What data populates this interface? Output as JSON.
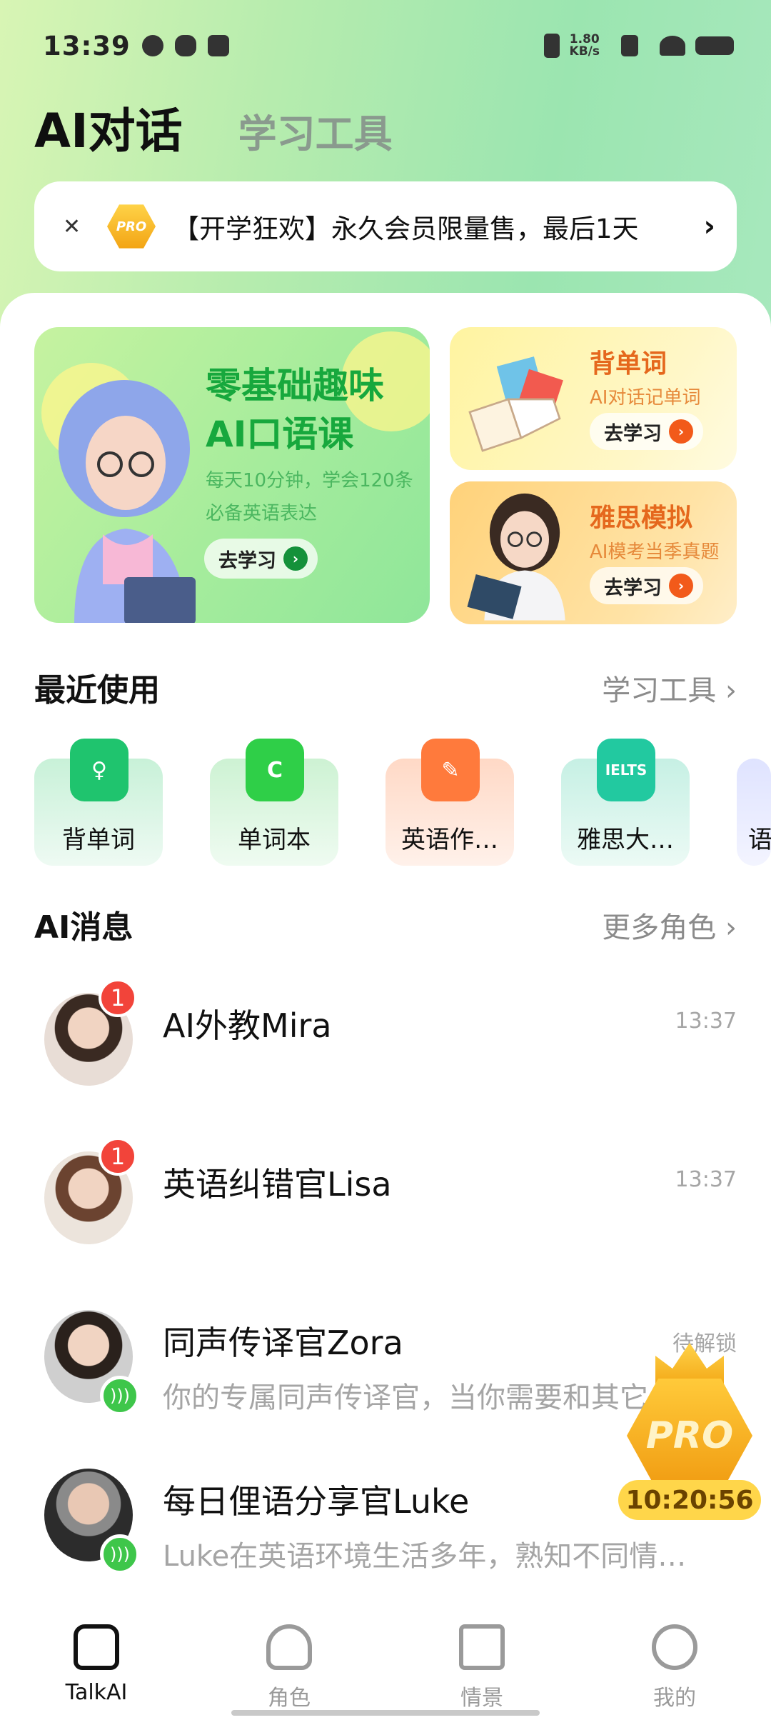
{
  "status_bar": {
    "time": "13:39",
    "net_speed_value": "1.80",
    "net_speed_unit": "KB/s"
  },
  "top_tabs": {
    "ai_chat": "AI对话",
    "tools": "学习工具"
  },
  "promo_banner": {
    "text": "【开学狂欢】永久会员限量售，最后1天",
    "badge": "PRO"
  },
  "feature_cards": {
    "oral_course": {
      "title_line1": "零基础趣味",
      "title_line2": "AI口语课",
      "desc": "每天10分钟，学会120条必备英语表达",
      "button": "去学习"
    },
    "vocab": {
      "title": "背单词",
      "desc": "AI对话记单词",
      "button": "去学习"
    },
    "ielts": {
      "title": "雅思模拟",
      "desc": "AI模考当季真题",
      "button": "去学习"
    }
  },
  "recent": {
    "title": "最近使用",
    "more": "学习工具",
    "tools": [
      {
        "label": "背单词",
        "color": "#1fc46e",
        "bg": "#d9f6e4"
      },
      {
        "label": "单词本",
        "color": "#2fcf48",
        "bg": "#dcf7df"
      },
      {
        "label": "英语作…",
        "color": "#ff7a3c",
        "bg": "#ffe5d8"
      },
      {
        "label": "雅思大…",
        "color": "#22c9a0",
        "bg": "#d6f5ec"
      },
      {
        "label": "语",
        "color": "#7b8cff",
        "bg": "#e6e9ff"
      }
    ]
  },
  "messages_section": {
    "title": "AI消息",
    "more": "更多角色"
  },
  "messages": [
    {
      "name": "AI外教Mira",
      "preview": "",
      "time": "13:37",
      "unread": "1"
    },
    {
      "name": "英语纠错官Lisa",
      "preview": "",
      "time": "13:37",
      "unread": "1"
    },
    {
      "name": "同声传译官Zora",
      "preview": "你的专属同声传译官，当你需要和其它",
      "time": "待解锁",
      "unread": ""
    },
    {
      "name": "每日俚语分享官Luke",
      "preview": "Luke在英语环境生活多年，熟知不同情…",
      "time": "",
      "unread": ""
    }
  ],
  "pro_float": {
    "label": "PRO",
    "timer": "10:20:56"
  },
  "bottom_nav": [
    {
      "label": "TalkAI",
      "active": true
    },
    {
      "label": "角色",
      "active": false
    },
    {
      "label": "情景",
      "active": false
    },
    {
      "label": "我的",
      "active": false
    }
  ],
  "colors": {
    "accent_green": "#17a83d",
    "orange": "#e5681d",
    "badge_red": "#f2443a"
  }
}
